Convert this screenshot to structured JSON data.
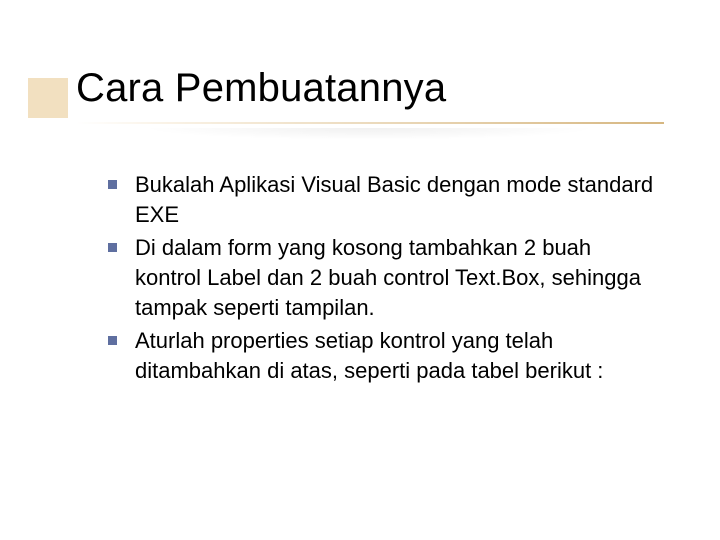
{
  "slide": {
    "title": "Cara Pembuatannya",
    "bullets": [
      {
        "text": "Bukalah Aplikasi Visual Basic dengan mode standard EXE"
      },
      {
        "text": "Di dalam form yang kosong tambahkan 2 buah kontrol Label dan 2 buah control Text.Box, sehingga tampak seperti tampilan."
      },
      {
        "text": "Aturlah properties setiap kontrol yang telah ditambahkan di atas,  seperti pada tabel berikut :"
      }
    ],
    "colors": {
      "accent_block": "#f2e0c0",
      "bullet": "#5f6fa0",
      "underline": "#d2af73"
    }
  }
}
